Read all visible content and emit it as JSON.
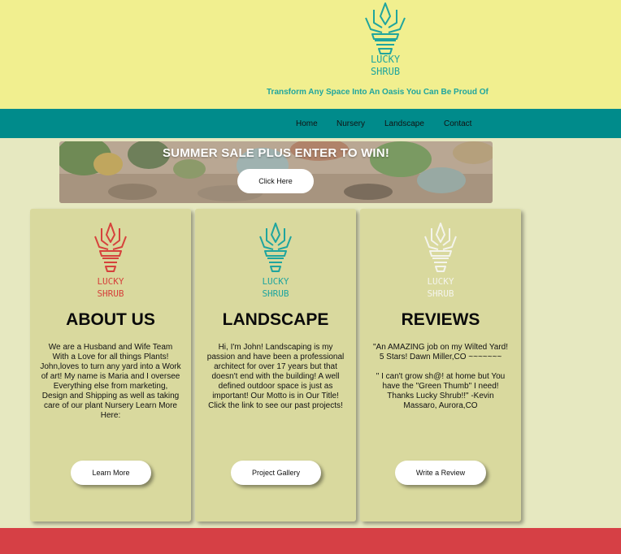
{
  "header": {
    "logo_line1": "LUCKY",
    "logo_line2": "SHRUB",
    "tagline": "Transform Any Space Into An Oasis You Can Be Proud Of"
  },
  "nav": {
    "items": [
      {
        "label": "Home"
      },
      {
        "label": "Nursery"
      },
      {
        "label": "Landscape"
      },
      {
        "label": "Contact"
      }
    ]
  },
  "banner": {
    "title": "SUMMER SALE PLUS ENTER TO WIN!",
    "button_label": "Click Here"
  },
  "cards": [
    {
      "title": "ABOUT US",
      "logo_color": "#d6423c",
      "text": [
        "We are a Husband and Wife Team With a Love for all things Plants! John,loves to turn any yard into a Work of art! My name is Maria and I oversee Everything else from marketing, Design and Shipping as well as taking care of our plant Nursery Learn More Here:"
      ],
      "button_label": "Learn More"
    },
    {
      "title": "LANDSCAPE",
      "logo_color": "#1fa59e",
      "text": [
        "Hi, I'm John! Landscaping is my passion and have been a professional architect for over 17 years but that doesn't end with the building! A well defined outdoor space is just as important! Our Motto is in Our Title! Click the link to see our past projects!"
      ],
      "button_label": "Project Gallery"
    },
    {
      "title": "REVIEWS",
      "logo_color": "#f4f4ec",
      "text": [
        "\"An AMAZING job on my Wilted Yard! 5 Stars! Dawn Miller,CO ~~~~~~~",
        "\" I can't grow sh@! at home but You have the \"Green Thumb\" I need! Thanks Lucky Shrub!!\" -Kevin Massaro, Aurora,CO"
      ],
      "button_label": "Write a Review"
    }
  ],
  "colors": {
    "header_bg": "#f1ef8f",
    "nav_bg": "#008b8b",
    "page_bg": "#e6e8c0",
    "card_bg": "#d9d99e",
    "footer_bg": "#d64045",
    "accent": "#1fa59e"
  }
}
